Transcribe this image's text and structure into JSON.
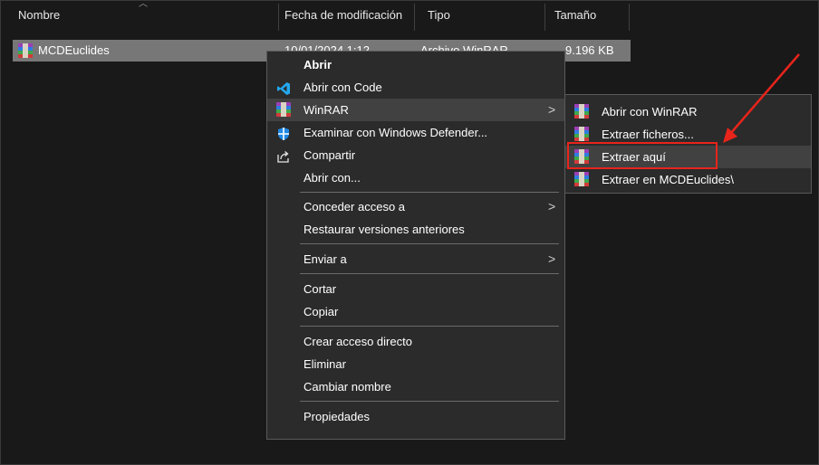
{
  "columns": {
    "name": "Nombre",
    "modified": "Fecha de modificación",
    "type": "Tipo",
    "size": "Tamaño"
  },
  "file": {
    "name": "MCDEuclides",
    "date": "10/01/2024 1:12",
    "type": "Archivo WinRAR",
    "size": "9.196 KB"
  },
  "context_menu": {
    "items": [
      {
        "label": "Abrir",
        "bold": true
      },
      {
        "label": "Abrir con Code",
        "icon": "vscode-icon"
      },
      {
        "label": "WinRAR",
        "icon": "winrar-icon",
        "submenu": true
      },
      {
        "label": "Examinar con Windows Defender...",
        "icon": "defender-shield-icon"
      },
      {
        "label": "Compartir",
        "icon": "share-icon"
      },
      {
        "label": "Abrir con..."
      },
      {
        "label": "Conceder acceso a",
        "submenu": true
      },
      {
        "label": "Restaurar versiones anteriores"
      },
      {
        "label": "Enviar a",
        "submenu": true
      },
      {
        "label": "Cortar"
      },
      {
        "label": "Copiar"
      },
      {
        "label": "Crear acceso directo"
      },
      {
        "label": "Eliminar"
      },
      {
        "label": "Cambiar nombre"
      },
      {
        "label": "Propiedades"
      }
    ]
  },
  "winrar_submenu": {
    "items": [
      {
        "label": "Abrir con WinRAR"
      },
      {
        "label": "Extraer ficheros..."
      },
      {
        "label": "Extraer aquí",
        "highlighted": true
      },
      {
        "label": "Extraer en MCDEuclides\\"
      }
    ]
  },
  "annotation": {
    "highlight_color": "#e8241b"
  }
}
